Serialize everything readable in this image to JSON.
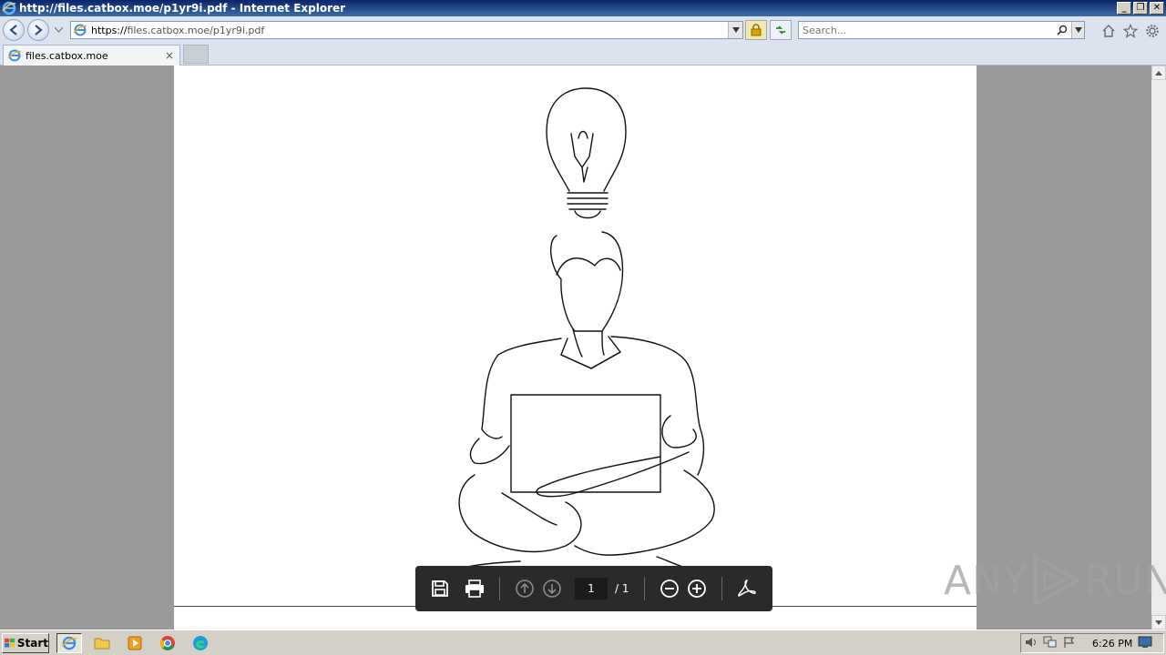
{
  "window": {
    "title": "http://files.catbox.moe/p1yr9i.pdf - Internet Explorer",
    "controls": {
      "minimize": "_",
      "restore": "❐",
      "close": "✕"
    }
  },
  "nav": {
    "url_scheme": "https://",
    "url_host": "files.catbox.moe",
    "url_path": "/p1yr9i.pdf",
    "search_placeholder": "Search..."
  },
  "tabs": [
    {
      "label": "files.catbox.moe",
      "close": "×"
    }
  ],
  "pdf_toolbar": {
    "current_page": "1",
    "total_pages": "/ 1"
  },
  "watermark": {
    "left": "ANY",
    "right": "RUN"
  },
  "taskbar": {
    "start_label": "Start",
    "clock": "6:26 PM"
  },
  "colors": {
    "titlebar": "#0a246a",
    "pdf_toolbar_bg": "#2a2a2a",
    "viewport_bg": "#9a9a9a"
  }
}
